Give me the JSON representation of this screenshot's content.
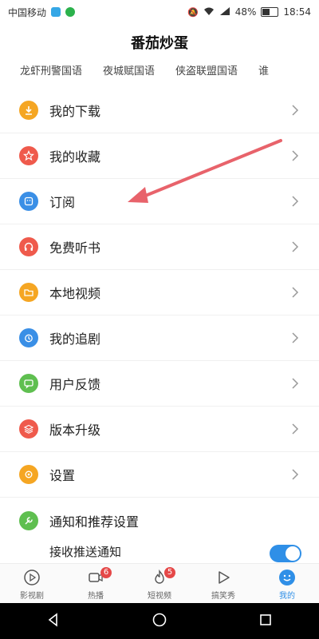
{
  "status_bar": {
    "carrier": "中国移动",
    "battery": "48%",
    "battery_level": 0.48,
    "time": "18:54"
  },
  "header": {
    "title": "番茄炒蛋"
  },
  "tabs": [
    {
      "label": "龙虾刑警国语"
    },
    {
      "label": "夜城赋国语"
    },
    {
      "label": "侠盗联盟国语"
    },
    {
      "label": "谁"
    }
  ],
  "menu": [
    {
      "label": "我的下载",
      "color": "#f5a623",
      "icon": "download-icon"
    },
    {
      "label": "我的收藏",
      "color": "#ef5a4c",
      "icon": "star-icon"
    },
    {
      "label": "订阅",
      "color": "#3a8fe6",
      "icon": "subscribe-icon"
    },
    {
      "label": "免费听书",
      "color": "#ef5a4c",
      "icon": "headphones-icon"
    },
    {
      "label": "本地视频",
      "color": "#f5a623",
      "icon": "folder-icon"
    },
    {
      "label": "我的追剧",
      "color": "#3a8fe6",
      "icon": "alarm-icon"
    },
    {
      "label": "用户反馈",
      "color": "#5fbf50",
      "icon": "feedback-icon"
    },
    {
      "label": "版本升级",
      "color": "#ef5a4c",
      "icon": "layers-icon"
    },
    {
      "label": "设置",
      "color": "#f5a623",
      "icon": "gear-icon"
    },
    {
      "label": "通知和推荐设置",
      "color": "#5fbf50",
      "icon": "wrench-icon"
    }
  ],
  "push_setting": {
    "label": "接收推送通知"
  },
  "bottom_nav": [
    {
      "label": "影视剧",
      "icon": "play-circle-icon"
    },
    {
      "label": "热播",
      "icon": "video-camera-icon",
      "badge": "6"
    },
    {
      "label": "短视频",
      "icon": "fire-icon",
      "badge": "5"
    },
    {
      "label": "搞笑秀",
      "icon": "play-triangle-icon"
    },
    {
      "label": "我的",
      "icon": "smile-icon",
      "active": true
    }
  ],
  "colors": {
    "accent": "#2f8fe7",
    "arrow": "#e8636b",
    "badge": "#e54848"
  }
}
